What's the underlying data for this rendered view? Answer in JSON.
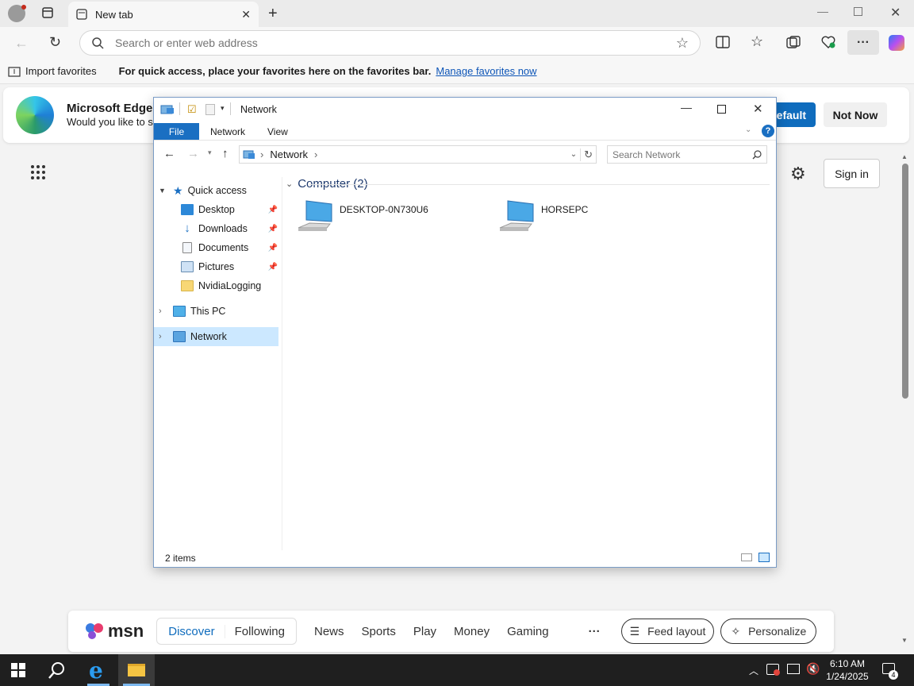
{
  "browser": {
    "tab_title": "New tab",
    "address_placeholder": "Search or enter web address",
    "favorites": {
      "import_label": "Import favorites",
      "prompt": "For quick access, place your favorites here on the favorites bar.",
      "manage_link": "Manage favorites now"
    }
  },
  "banner": {
    "title": "Microsoft Edge",
    "subtitle": "Would you like to se",
    "default_button": "efault",
    "not_now_button": "Not Now"
  },
  "page": {
    "sign_in": "Sign in"
  },
  "explorer": {
    "title": "Network",
    "ribbon_tabs": [
      "File",
      "Network",
      "View"
    ],
    "breadcrumb": "Network",
    "search_placeholder": "Search Network",
    "group_header": "Computer (2)",
    "items": [
      "DESKTOP-0N730U6",
      "HORSEPC"
    ],
    "tree": {
      "quick_access": "Quick access",
      "desktop": "Desktop",
      "downloads": "Downloads",
      "documents": "Documents",
      "pictures": "Pictures",
      "nvidia": "NvidiaLogging",
      "this_pc": "This PC",
      "network": "Network"
    },
    "status": "2 items"
  },
  "msn": {
    "logo": "msn",
    "tabs": [
      "Discover",
      "Following",
      "News",
      "Sports",
      "Play",
      "Money",
      "Gaming"
    ],
    "more": "···",
    "feed_layout": "Feed layout",
    "personalize": "Personalize"
  },
  "taskbar": {
    "time": "6:10 AM",
    "date": "1/24/2025",
    "notification_count": "4"
  },
  "colors": {
    "accent": "#0d55b7",
    "file_tab": "#1a6fc2",
    "selected_tree": "#cce8ff",
    "taskbar": "#1f1f1f"
  }
}
